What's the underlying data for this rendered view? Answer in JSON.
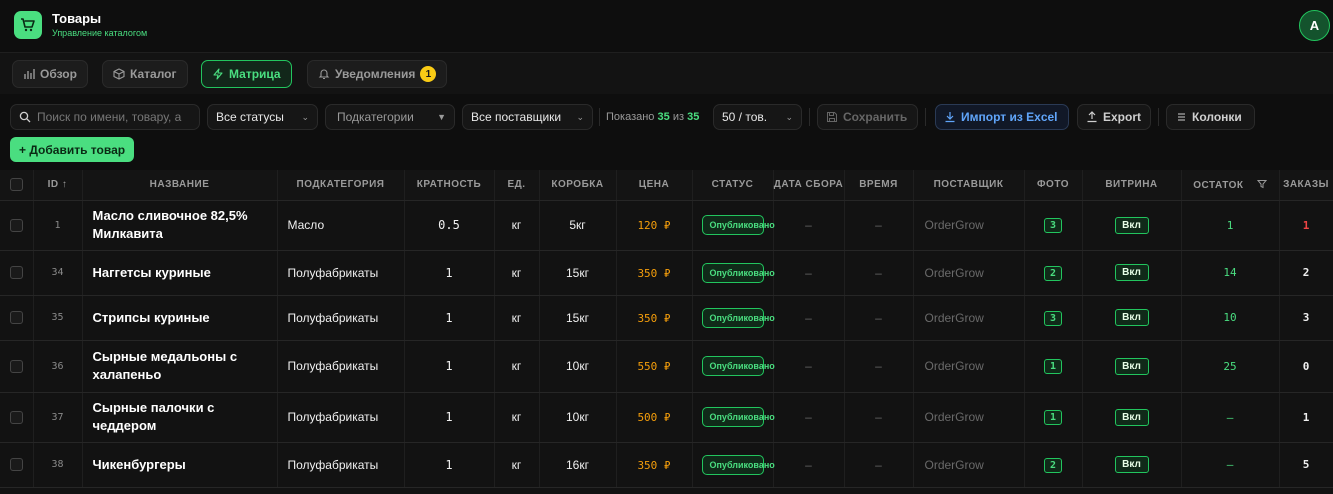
{
  "app": {
    "title": "Товары",
    "subtitle": "Управление каталогом",
    "avatar": "A"
  },
  "tabs": [
    {
      "label": "Обзор",
      "icon": "bar-chart-icon"
    },
    {
      "label": "Каталог",
      "icon": "box-icon"
    },
    {
      "label": "Матрица",
      "icon": "bolt-icon"
    },
    {
      "label": "Уведомления",
      "icon": "bell-icon",
      "badge": "1"
    }
  ],
  "toolbar": {
    "search_placeholder": "Поиск по имени, товару, а",
    "status_filter": "Все статусы",
    "subcategory_filter": "Подкатегории",
    "supplier_filter": "Все поставщики",
    "shown_prefix": "Показано",
    "shown_count": "35",
    "shown_mid": "из",
    "shown_total": "35",
    "page_size": "50 / тов.",
    "save_label": "Сохранить",
    "import_label": "Импорт из Excel",
    "export_label": "Export",
    "columns_label": "Колонки",
    "add_label": "+ Добавить товар"
  },
  "table": {
    "headers": {
      "id": "ID ↑",
      "name": "Название",
      "subcategory": "Подкатегория",
      "multiplicity": "Кратность",
      "unit": "Ед.",
      "box": "Коробка",
      "price": "Цена",
      "status": "Статус",
      "collect_date": "Дата сбора",
      "time": "Время",
      "supplier": "Поставщик",
      "photo": "Фото",
      "vitrina": "Витрина",
      "stock": "Остаток",
      "orders": "Заказы"
    },
    "rows": [
      {
        "id": "1",
        "name": "Масло сливочное 82,5% Милкавита",
        "subcategory": "Масло",
        "multiplicity": "0.5",
        "unit": "кг",
        "box": "5кг",
        "price": "120 ₽",
        "status": "Опубликовано",
        "collect_date": "–",
        "time": "–",
        "supplier": "OrderGrow",
        "photo": "3",
        "vitrina": "Вкл",
        "stock": "1",
        "orders": "1"
      },
      {
        "id": "34",
        "name": "Наггетсы куриные",
        "subcategory": "Полуфабрикаты",
        "multiplicity": "1",
        "unit": "кг",
        "box": "15кг",
        "price": "350 ₽",
        "status": "Опубликовано",
        "collect_date": "–",
        "time": "–",
        "supplier": "OrderGrow",
        "photo": "2",
        "vitrina": "Вкл",
        "stock": "14",
        "orders": "2"
      },
      {
        "id": "35",
        "name": "Стрипсы куриные",
        "subcategory": "Полуфабрикаты",
        "multiplicity": "1",
        "unit": "кг",
        "box": "15кг",
        "price": "350 ₽",
        "status": "Опубликовано",
        "collect_date": "–",
        "time": "–",
        "supplier": "OrderGrow",
        "photo": "3",
        "vitrina": "Вкл",
        "stock": "10",
        "orders": "3"
      },
      {
        "id": "36",
        "name": "Сырные медальоны с халапеньо",
        "subcategory": "Полуфабрикаты",
        "multiplicity": "1",
        "unit": "кг",
        "box": "10кг",
        "price": "550 ₽",
        "status": "Опубликовано",
        "collect_date": "–",
        "time": "–",
        "supplier": "OrderGrow",
        "photo": "1",
        "vitrina": "Вкл",
        "stock": "25",
        "orders": "0"
      },
      {
        "id": "37",
        "name": "Сырные палочки с чеддером",
        "subcategory": "Полуфабрикаты",
        "multiplicity": "1",
        "unit": "кг",
        "box": "10кг",
        "price": "500 ₽",
        "status": "Опубликовано",
        "collect_date": "–",
        "time": "–",
        "supplier": "OrderGrow",
        "photo": "1",
        "vitrina": "Вкл",
        "stock": "–",
        "orders": "1"
      },
      {
        "id": "38",
        "name": "Чикенбургеры",
        "subcategory": "Полуфабрикаты",
        "multiplicity": "1",
        "unit": "кг",
        "box": "16кг",
        "price": "350 ₽",
        "status": "Опубликовано",
        "collect_date": "–",
        "time": "–",
        "supplier": "OrderGrow",
        "photo": "2",
        "vitrina": "Вкл",
        "stock": "–",
        "orders": "5"
      }
    ]
  },
  "colors": {
    "accent": "#4ade80",
    "price": "#f59e0b",
    "badge": "#facc15",
    "import": "#60a5fa",
    "danger": "#ef4444"
  }
}
